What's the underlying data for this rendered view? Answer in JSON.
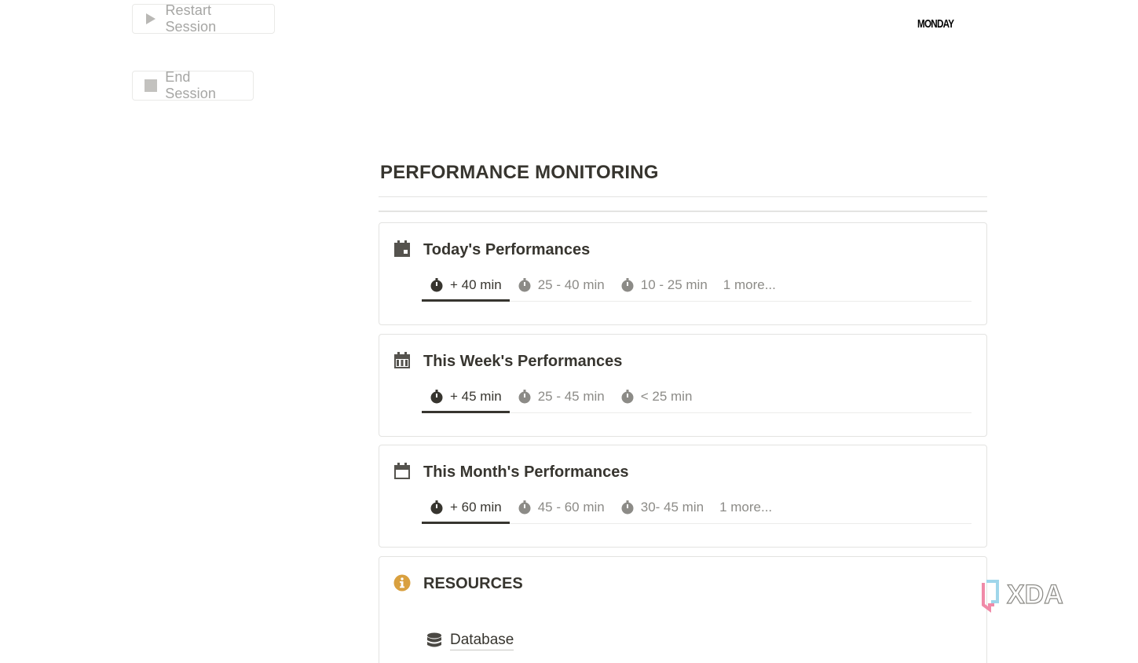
{
  "session": {
    "restart_label": "Restart Session",
    "end_label": "End Session"
  },
  "day_label": "MONDAY",
  "page": {
    "title": "PERFORMANCE MONITORING"
  },
  "cards": {
    "today": {
      "title": "Today's Performances",
      "icon": "calendar-today-icon",
      "tabs": [
        "+ 40 min",
        "25 - 40 min",
        "10 - 25 min"
      ],
      "more": "1 more..."
    },
    "week": {
      "title": "This Week's Performances",
      "icon": "calendar-week-icon",
      "tabs": [
        "+ 45 min",
        "25 - 45 min",
        "< 25 min"
      ]
    },
    "month": {
      "title": "This Month's Performances",
      "icon": "calendar-month-icon",
      "tabs": [
        "+ 60 min",
        "45 - 60 min",
        "30- 45 min"
      ],
      "more": "1 more..."
    },
    "resources": {
      "title": "RESOURCES",
      "icon": "info-icon",
      "accent": "#d9a03f",
      "items": [
        "Database"
      ]
    }
  },
  "watermark": {
    "text": "XDA"
  }
}
